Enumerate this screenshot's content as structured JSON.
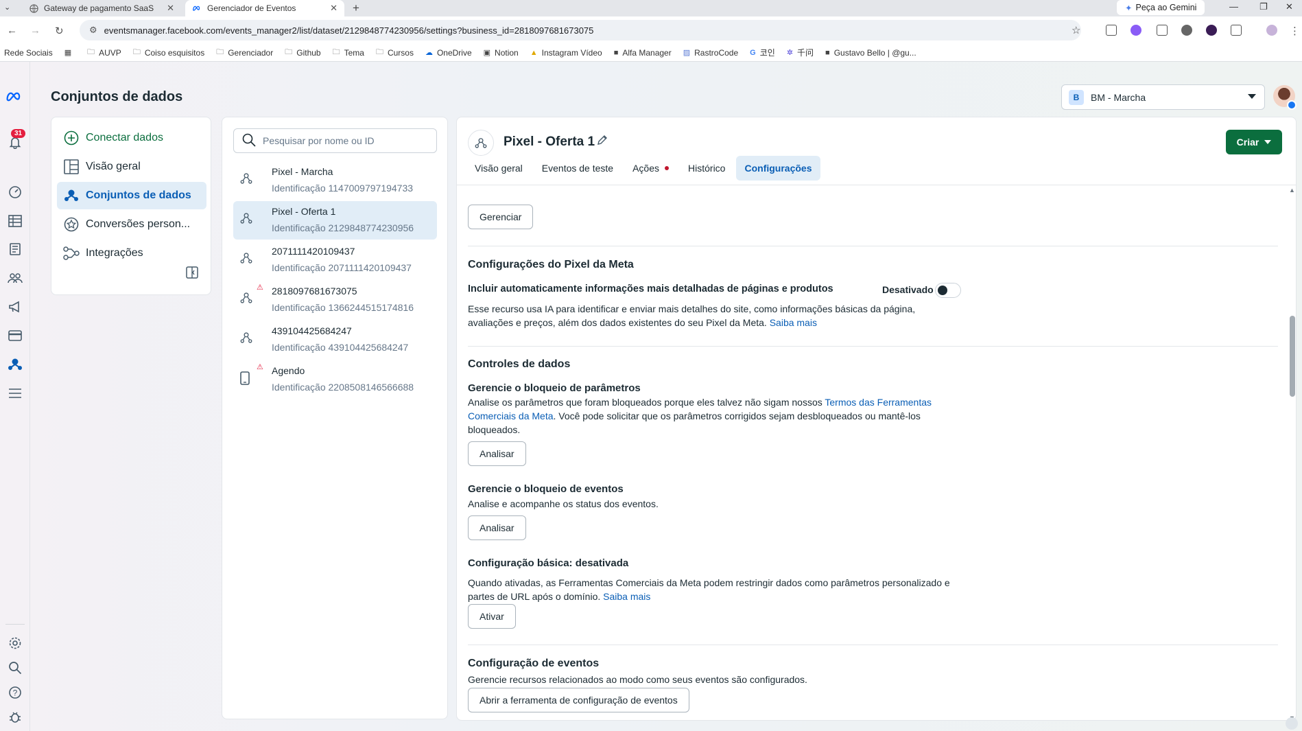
{
  "browser": {
    "tabs": [
      {
        "title": "Gateway de pagamento SaaS",
        "active": false
      },
      {
        "title": "Gerenciador de Eventos",
        "active": true
      }
    ],
    "gemini_label": "Peça ao Gemini",
    "url": "eventsmanager.facebook.com/events_manager2/list/dataset/2129848774230956/settings?business_id=2818097681673075",
    "bookmarks": [
      "Rede Sociais",
      "AUVP",
      "Coiso esquisitos",
      "Gerenciador",
      "Github",
      "Tema",
      "Cursos",
      "OneDrive",
      "Notion",
      "Instagram Vídeo",
      "Alfa Manager",
      "RastroCode",
      "코인",
      "千问",
      "Gustavo Bello | @gu..."
    ]
  },
  "app": {
    "page_title": "Conjuntos de dados",
    "notifications_count": "31",
    "business": {
      "letter": "B",
      "name": "BM - Marcha"
    },
    "left_nav": [
      {
        "label": "Conectar dados"
      },
      {
        "label": "Visão geral"
      },
      {
        "label": "Conjuntos de dados",
        "selected": true
      },
      {
        "label": "Conversões person..."
      },
      {
        "label": "Integrações"
      }
    ],
    "search_placeholder": "Pesquisar por nome ou ID",
    "datasets": [
      {
        "name": "Pixel - Marcha",
        "id": "Identificação 1147009797194733",
        "icon": "pixel-icon",
        "warning": false
      },
      {
        "name": "Pixel - Oferta 1",
        "id": "Identificação 2129848774230956",
        "icon": "pixel-icon",
        "warning": false,
        "selected": true
      },
      {
        "name": "2071111420109437",
        "id": "Identificação 2071111420109437",
        "icon": "pixel-icon",
        "warning": false
      },
      {
        "name": "2818097681673075",
        "id": "Identificação 1366244515174816",
        "icon": "pixel-icon",
        "warning": true
      },
      {
        "name": "439104425684247",
        "id": "Identificação 439104425684247",
        "icon": "pixel-icon",
        "warning": false
      },
      {
        "name": "Agendo",
        "id": "Identificação 2208508146566688",
        "icon": "phone-icon",
        "warning": true
      }
    ],
    "main": {
      "title": "Pixel - Oferta 1",
      "create_label": "Criar",
      "tabs": [
        "Visão geral",
        "Eventos de teste",
        "Ações",
        "Histórico",
        "Configurações"
      ],
      "manage_button": "Gerenciar",
      "pixel_settings": {
        "heading": "Configurações do Pixel da Meta",
        "option_title": "Incluir automaticamente informações mais detalhadas de páginas e produtos",
        "toggle_label": "Desativado",
        "description": "Esse recurso usa IA para identificar e enviar mais detalhes do site, como informações básicas da página, avaliações e preços, além dos dados existentes do seu Pixel da Meta.",
        "learn_more": "Saiba mais"
      },
      "data_controls": {
        "heading": "Controles de dados",
        "param_title": "Gerencie o bloqueio de parâmetros",
        "param_text_1": "Analise os parâmetros que foram bloqueados porque eles talvez não sigam nossos",
        "param_link": "Termos das Ferramentas Comerciais da Meta",
        "param_text_2": ". Você pode solicitar que os parâmetros corrigidos sejam desbloqueados ou mantê-los bloqueados.",
        "analyze_label": "Analisar",
        "events_title": "Gerencie o bloqueio de eventos",
        "events_text": "Analise e acompanhe os status dos eventos.",
        "basic_title": "Configuração básica: desativada",
        "basic_text": "Quando ativadas, as Ferramentas Comerciais da Meta podem restringir dados como parâmetros personalizado e partes de URL após o domínio.",
        "basic_link": "Saiba mais",
        "activate_label": "Ativar"
      },
      "event_config": {
        "heading": "Configuração de eventos",
        "text": "Gerencie recursos relacionados ao modo como seus eventos são configurados.",
        "button": "Abrir a ferramenta de configuração de eventos"
      }
    }
  },
  "colors": {
    "accent_blue": "#0a5eb5",
    "create_green": "#0b6e3e",
    "alert_red": "#e41e3f"
  }
}
